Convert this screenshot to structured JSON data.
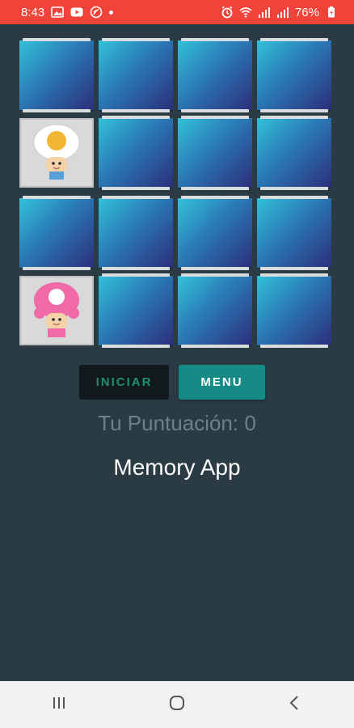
{
  "status_bar": {
    "time": "8:43",
    "battery": "76%",
    "left_icons": [
      "gallery-icon",
      "youtube-icon",
      "cast-icon",
      "dot-icon"
    ],
    "right_icons": [
      "alarm-icon",
      "wifi-icon",
      "signal-icon",
      "signal-icon",
      "battery-icon"
    ]
  },
  "board": {
    "rows": 4,
    "cols": 4,
    "cards": [
      [
        "back",
        "back",
        "back",
        "back"
      ],
      [
        "yellow-toad",
        "back",
        "back",
        "back"
      ],
      [
        "back",
        "back",
        "back",
        "back"
      ],
      [
        "pink-toadette",
        "back",
        "back",
        "back"
      ]
    ]
  },
  "controls": {
    "start_label": "INICIAR",
    "menu_label": "MENU"
  },
  "score_text": "Tu Puntuación: 0",
  "app_title": "Memory App",
  "nav": {
    "buttons": [
      "recent-apps-icon",
      "home-icon",
      "back-icon"
    ]
  },
  "colors": {
    "status_bar": "#f0443a",
    "background": "#2a3b44",
    "card_back_start": "#32c2d8",
    "card_back_end": "#2c2e7a",
    "start_button": "#11191c",
    "start_text": "#1f8f73",
    "menu_button": "#168a84"
  }
}
